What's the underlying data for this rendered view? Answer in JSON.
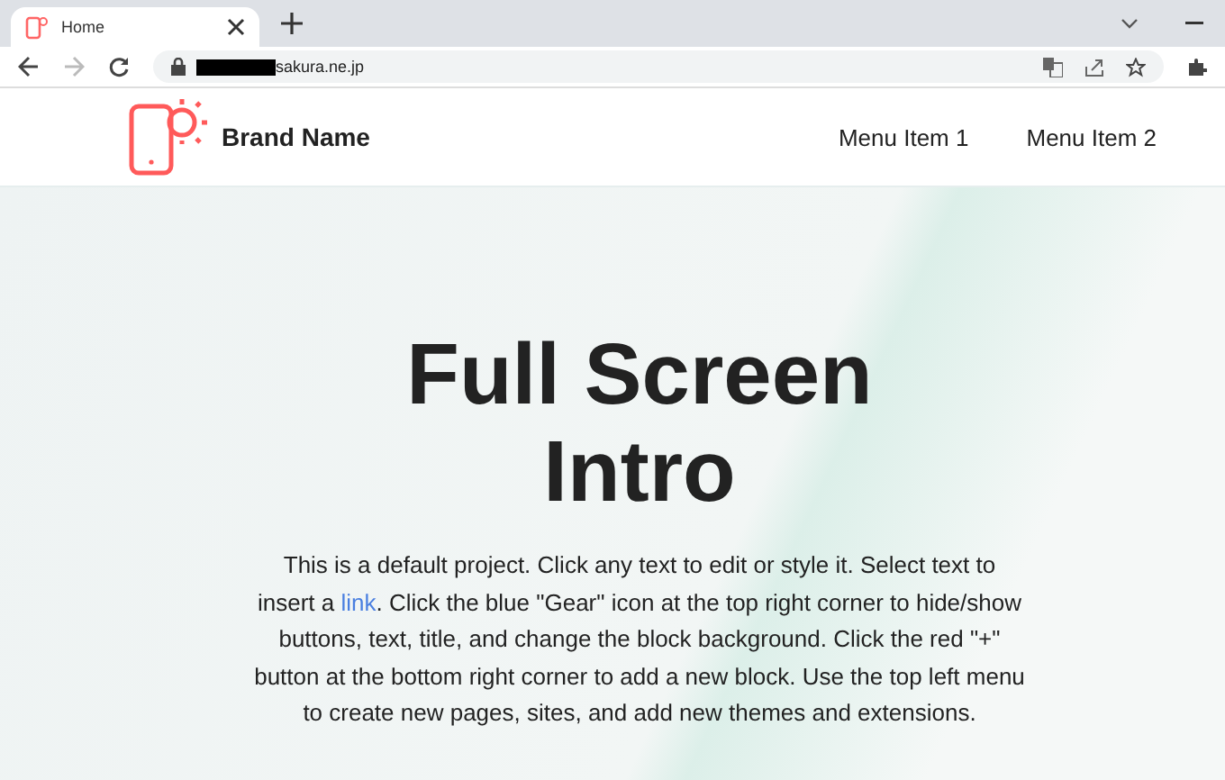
{
  "browser": {
    "tab": {
      "title": "Home",
      "selected": true
    },
    "address": {
      "url": "sakura.ne.jp"
    }
  },
  "navbar": {
    "brand": "Brand Name",
    "menu": [
      {
        "label": "Menu Item 1"
      },
      {
        "label": "Menu Item 2"
      }
    ]
  },
  "hero": {
    "title": "Full Screen Intro",
    "text": {
      "before": "This is a default project. Click any text to edit or style it. Select text to insert a ",
      "link": "link",
      "after": ". Click the blue \"Gear\" icon at the top right corner to hide/show buttons, text, title, and change the block background. Click the red \"+\" button at the bottom right corner to add a new block. Use the top left menu to create new pages, sites, and add new themes and extensions."
    }
  }
}
